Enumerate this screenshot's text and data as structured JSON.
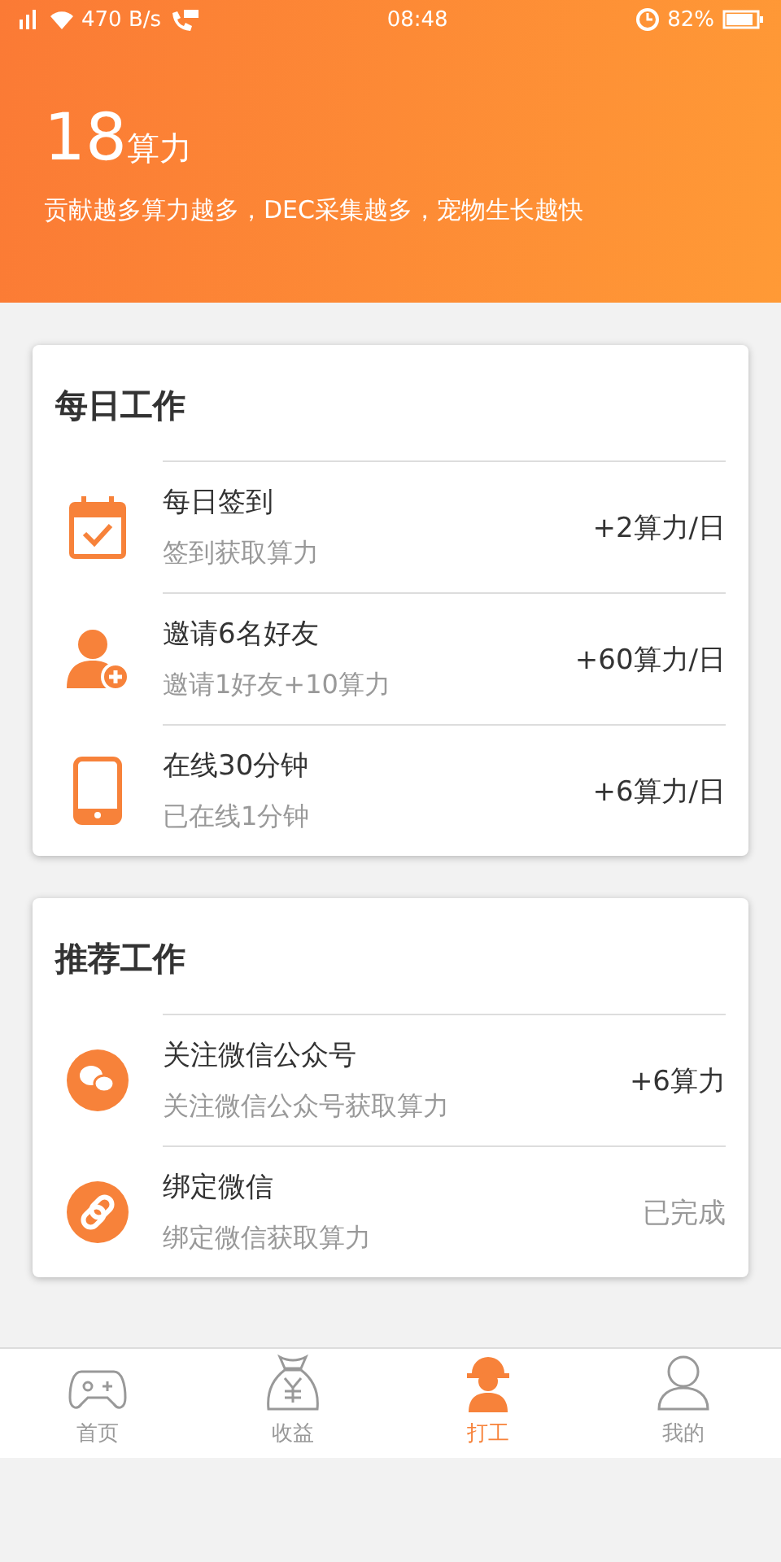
{
  "status_bar": {
    "speed": "470 B/s",
    "time": "08:48",
    "battery": "82%"
  },
  "header": {
    "amount": "18",
    "unit": "算力",
    "slogan": "贡献越多算力越多，DEC采集越多，宠物生长越快"
  },
  "sections": [
    {
      "title": "每日工作",
      "tasks": [
        {
          "kind": "calendar",
          "title": "每日签到",
          "subtitle": "签到获取算力",
          "reward": "+2算力/日",
          "completed": false
        },
        {
          "kind": "invite",
          "title": "邀请6名好友",
          "subtitle": "邀请1好友+10算力",
          "reward": "+60算力/日",
          "completed": false
        },
        {
          "kind": "phone",
          "title": "在线30分钟",
          "subtitle": "已在线1分钟",
          "reward": "+6算力/日",
          "completed": false
        }
      ]
    },
    {
      "title": "推荐工作",
      "tasks": [
        {
          "kind": "chat",
          "title": "关注微信公众号",
          "subtitle": "关注微信公众号获取算力",
          "reward": "+6算力",
          "completed": false
        },
        {
          "kind": "link",
          "title": "绑定微信",
          "subtitle": "绑定微信获取算力",
          "reward": "已完成",
          "completed": true
        }
      ]
    }
  ],
  "tabs": [
    {
      "kind": "gamepad",
      "label": "首页",
      "selected": false
    },
    {
      "kind": "moneybag",
      "label": "收益",
      "selected": false
    },
    {
      "kind": "worker",
      "label": "打工",
      "selected": true
    },
    {
      "kind": "person",
      "label": "我的",
      "selected": false
    }
  ]
}
